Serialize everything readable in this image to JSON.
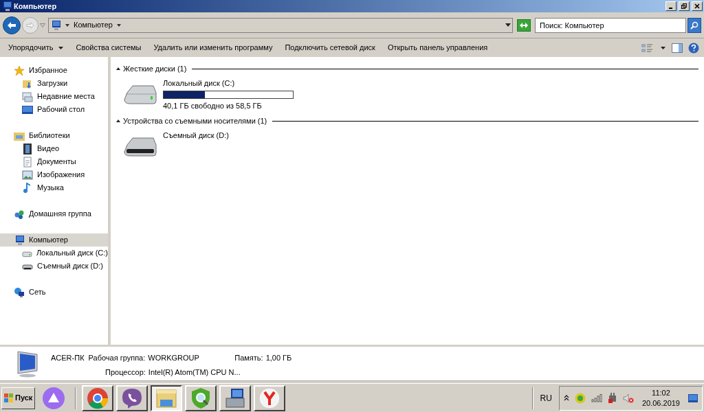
{
  "window": {
    "title": "Компьютер"
  },
  "address": {
    "path": "Компьютер"
  },
  "search": {
    "placeholder": "Поиск: Компьютер"
  },
  "toolbar": [
    {
      "label": "Упорядочить",
      "dropdown": true
    },
    {
      "label": "Свойства системы",
      "dropdown": false
    },
    {
      "label": "Удалить или изменить программу",
      "dropdown": false
    },
    {
      "label": "Подключить сетевой диск",
      "dropdown": false
    },
    {
      "label": "Открыть панель управления",
      "dropdown": false
    }
  ],
  "sidebar": [
    {
      "label": "Избранное",
      "kind": "star",
      "selected": false,
      "children": [
        {
          "label": "Загрузки",
          "kind": "download",
          "selected": false
        },
        {
          "label": "Недавние места",
          "kind": "recent",
          "selected": false
        },
        {
          "label": "Рабочий стол",
          "kind": "desktop",
          "selected": false
        }
      ]
    },
    {
      "label": "Библиотеки",
      "kind": "library",
      "selected": false,
      "children": [
        {
          "label": "Видео",
          "kind": "video",
          "selected": false
        },
        {
          "label": "Документы",
          "kind": "document",
          "selected": false
        },
        {
          "label": "Изображения",
          "kind": "image",
          "selected": false
        },
        {
          "label": "Музыка",
          "kind": "music",
          "selected": false
        }
      ]
    },
    {
      "label": "Домашняя группа",
      "kind": "homegroup",
      "selected": false
    },
    {
      "label": "Компьютер",
      "kind": "computer",
      "selected": true,
      "children": [
        {
          "label": "Локальный диск (C:)",
          "kind": "hdd",
          "selected": false
        },
        {
          "label": "Съемный диск (D:)",
          "kind": "removable",
          "selected": false
        }
      ]
    },
    {
      "label": "Сеть",
      "kind": "network",
      "selected": false
    }
  ],
  "sections": [
    {
      "title": "Жесткие диски (1)",
      "expanded": true,
      "items": [
        {
          "kind": "hdd",
          "name": "Локальный диск (C:)",
          "level": 0.32,
          "free": "40,1 ГБ свободно из 58,5 ГБ"
        }
      ]
    },
    {
      "title": "Устройства со съемными носителями (1)",
      "expanded": true,
      "items": [
        {
          "kind": "removable",
          "name": "Съемный диск (D:)"
        }
      ]
    }
  ],
  "details": {
    "name": "ACER-ПК",
    "workgroup_label": "Рабочая группа:",
    "workgroup": "WORKGROUP",
    "memory_label": "Память:",
    "memory": "1,00 ГБ",
    "cpu_label": "Процессор:",
    "cpu": "Intel(R) Atom(TM) CPU N..."
  },
  "taskbar": {
    "start": "Пуск",
    "apps": [
      {
        "kind": "assistant",
        "selected": false
      },
      {
        "kind": "separator"
      },
      {
        "kind": "chrome",
        "selected": false
      },
      {
        "kind": "viber",
        "selected": false
      },
      {
        "kind": "explorer",
        "selected": true
      },
      {
        "kind": "antivirus",
        "selected": false
      },
      {
        "kind": "control",
        "selected": false
      },
      {
        "kind": "yandex",
        "selected": false
      }
    ],
    "language": "RU",
    "time": "11:02",
    "date": "20.06.2019"
  }
}
